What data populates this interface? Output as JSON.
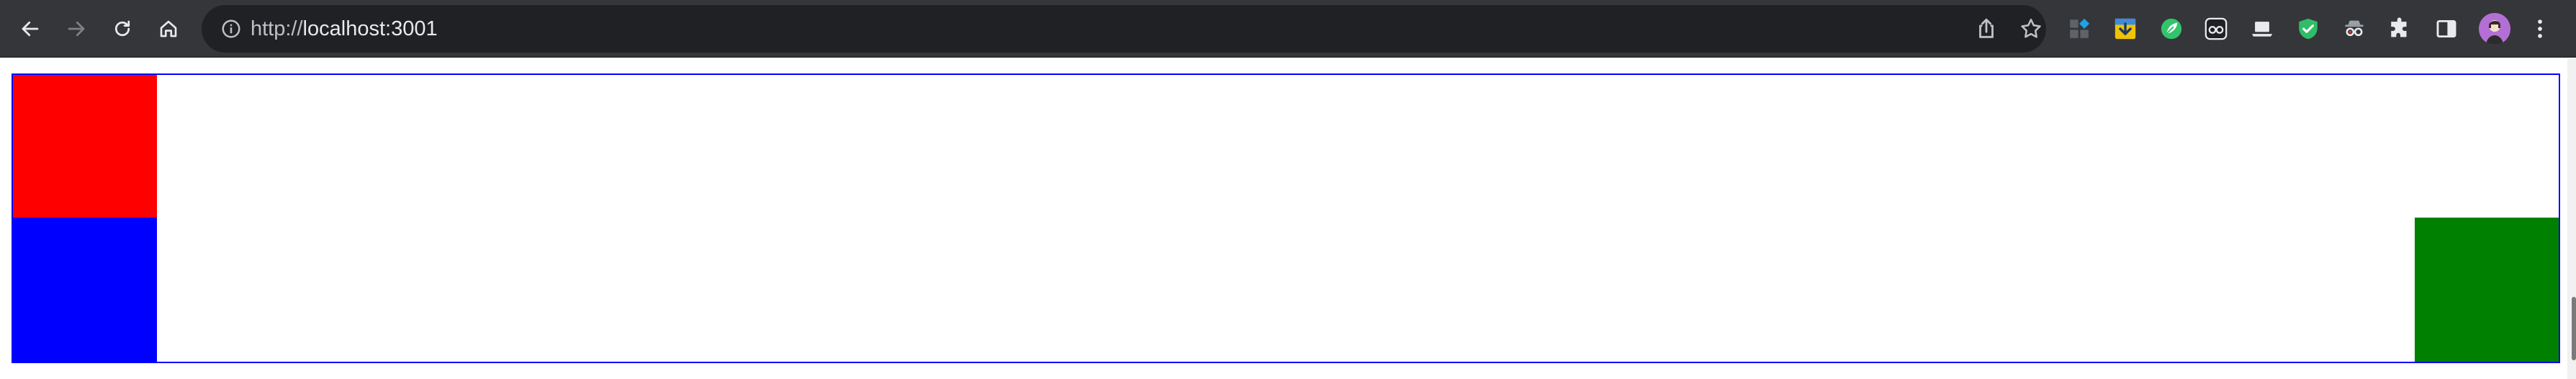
{
  "browser": {
    "url_scheme": "http://",
    "url_host": "localhost",
    "url_port": ":3001",
    "icons": {
      "back": "arrow-left-icon",
      "forward": "arrow-right-icon",
      "reload": "reload-icon",
      "home": "home-icon",
      "site_info": "info-icon",
      "share": "share-icon",
      "bookmark": "star-icon",
      "extensions": [
        "grid-extension-icon",
        "download-extension-icon",
        "leaf-extension-icon",
        "glasses-extension-icon",
        "laptop-extension-icon",
        "shield-extension-icon",
        "spy-extension-icon",
        "puzzle-icon"
      ],
      "side_panel": "side-panel-icon",
      "menu": "kebab-menu-icon"
    }
  },
  "page": {
    "container_border_color": "#0000ff",
    "boxes": [
      {
        "name": "red-box",
        "color": "#ff0000"
      },
      {
        "name": "blue-box",
        "color": "#0000ff"
      },
      {
        "name": "green-box",
        "color": "#008000"
      }
    ]
  }
}
